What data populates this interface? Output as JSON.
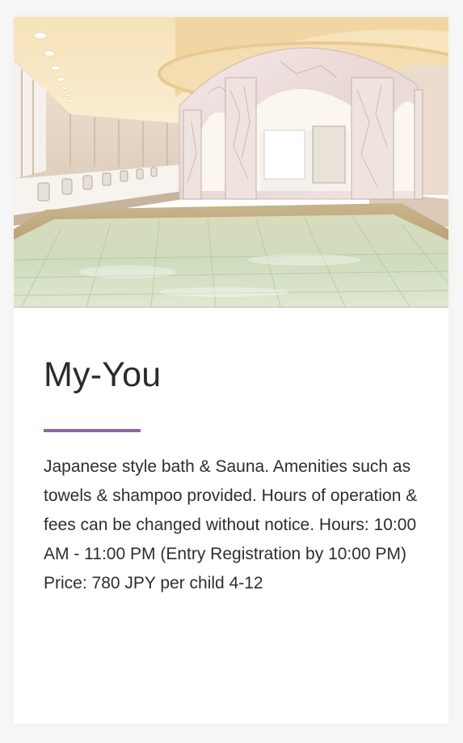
{
  "card": {
    "image_alt": "Japanese style public bath interior with marble columns and a large tiled pool",
    "title": "My-You",
    "description": "Japanese style bath & Sauna. Amenities such as towels & shampoo provided. Hours of operation & fees can be changed without notice. Hours: 10:00 AM - 11:00 PM (Entry Registration by 10:00 PM) Price: 780 JPY per child 4-12"
  },
  "colors": {
    "accent": "#8a67a6",
    "title": "#2b2b2b",
    "text": "#2e2e2e",
    "background": "#f7f7f7",
    "card": "#ffffff"
  }
}
